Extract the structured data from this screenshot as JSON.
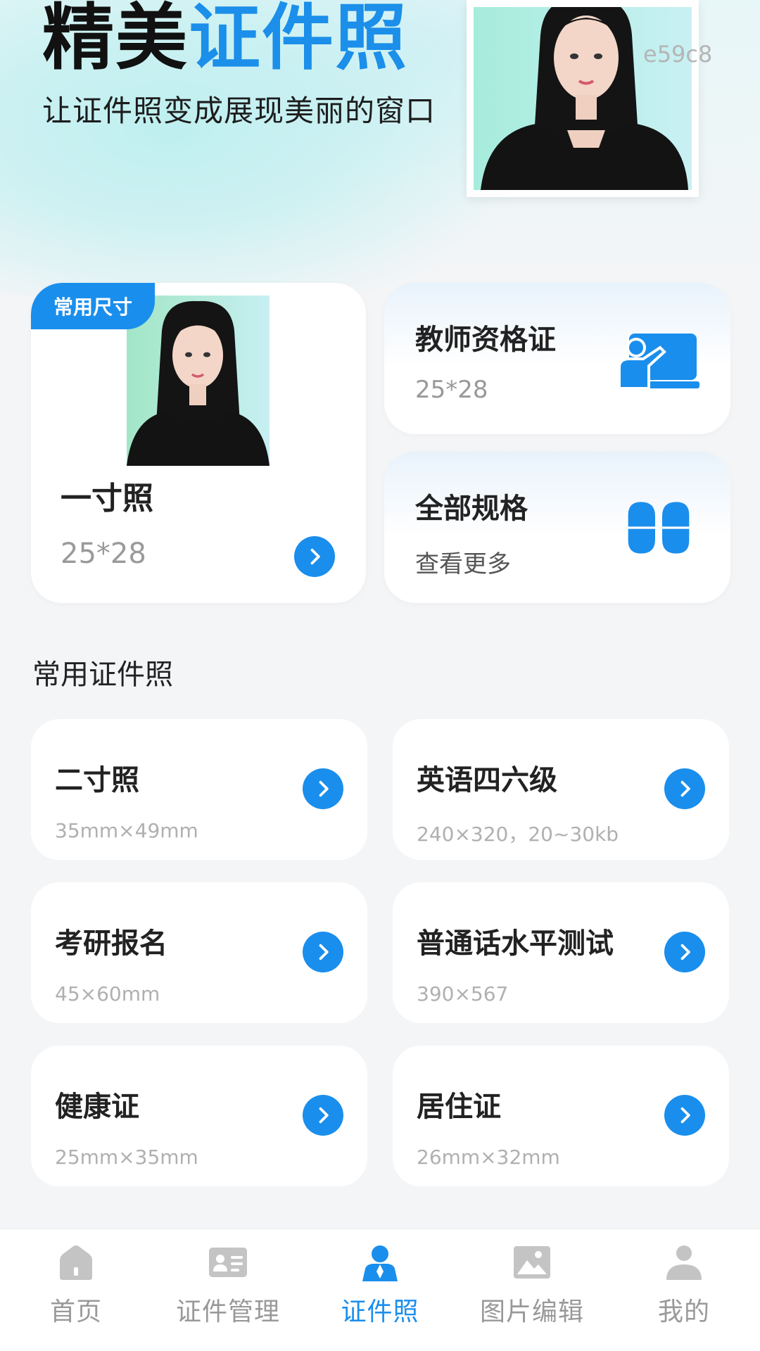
{
  "hero": {
    "title_black": "精美",
    "title_blue": "证件照",
    "subtitle": "让证件照变成展现美丽的窗口",
    "watermark": "e59c8"
  },
  "featured": {
    "badge": "常用尺寸",
    "title": "一寸照",
    "size": "25*28"
  },
  "side_cards": [
    {
      "title": "教师资格证",
      "subtitle": "25*28",
      "icon": "teacher-board-icon"
    },
    {
      "title": "全部规格",
      "subtitle": "查看更多",
      "icon": "four-petal-grid-icon"
    }
  ],
  "section_title": "常用证件照",
  "items": [
    {
      "title": "二寸照",
      "spec": "35mm×49mm"
    },
    {
      "title": "英语四六级",
      "spec": "240×320，20~30kb"
    },
    {
      "title": "考研报名",
      "spec": "45×60mm"
    },
    {
      "title": "普通话水平测试",
      "spec": "390×567"
    },
    {
      "title": "健康证",
      "spec": "25mm×35mm"
    },
    {
      "title": "居住证",
      "spec": "26mm×32mm"
    }
  ],
  "tabs": [
    {
      "label": "首页",
      "icon": "home-icon"
    },
    {
      "label": "证件管理",
      "icon": "id-card-icon"
    },
    {
      "label": "证件照",
      "icon": "person-portrait-icon",
      "active": true
    },
    {
      "label": "图片编辑",
      "icon": "image-icon"
    },
    {
      "label": "我的",
      "icon": "user-icon"
    }
  ],
  "colors": {
    "accent": "#1a8eec",
    "tab_inactive": "#999999",
    "background": "#f4f5f7"
  }
}
